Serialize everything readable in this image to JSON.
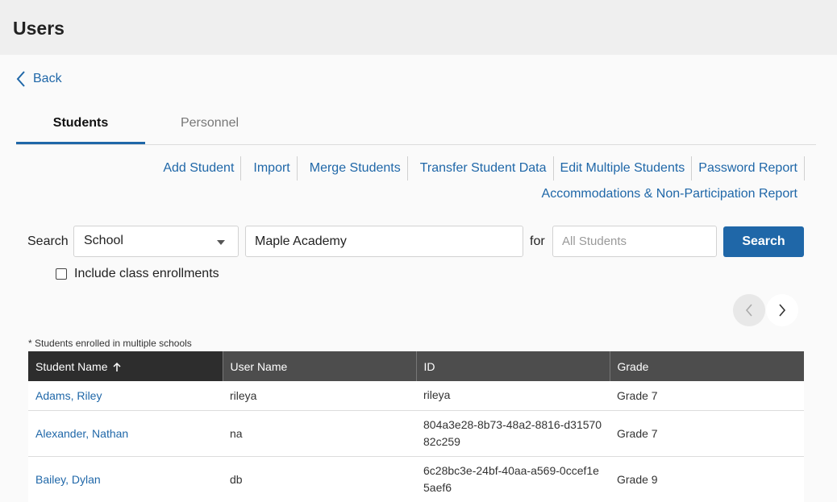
{
  "page": {
    "title": "Users"
  },
  "back": {
    "label": "Back"
  },
  "tabs": [
    {
      "label": "Students",
      "active": true
    },
    {
      "label": "Personnel",
      "active": false
    }
  ],
  "actions": {
    "add_student": "Add Student",
    "import": "Import",
    "merge_students": "Merge Students",
    "transfer_student_data": "Transfer Student Data",
    "edit_multiple_students": "Edit Multiple Students",
    "password_report": "Password Report",
    "accommodations_report": "Accommodations & Non-Participation Report"
  },
  "search": {
    "label": "Search",
    "scope_value": "School",
    "school_value": "Maple Academy",
    "for_label": "for",
    "student_placeholder": "All Students",
    "button_label": "Search"
  },
  "filters": {
    "include_class_enrollments": "Include class enrollments",
    "include_checked": false
  },
  "note": "* Students enrolled in multiple schools",
  "table": {
    "headers": [
      "Student Name",
      "User Name",
      "ID",
      "Grade"
    ],
    "sorted_column": "Student Name",
    "sort_direction": "ascending",
    "rows": [
      {
        "name": "Adams, Riley",
        "username": "rileya",
        "id": "rileya",
        "grade": "Grade 7"
      },
      {
        "name": "Alexander, Nathan",
        "username": "na",
        "id": "804a3e28-8b73-48a2-8816-d3157082c259",
        "grade": "Grade 7"
      },
      {
        "name": "Bailey, Dylan",
        "username": "db",
        "id": "6c28bc3e-24bf-40aa-a569-0ccef1e5aef6",
        "grade": "Grade 9"
      }
    ]
  },
  "colors": {
    "accent": "#1f67a8",
    "header_bg": "#efefef",
    "table_header": "#4d4d4d",
    "table_header_sorted": "#2d2d2d"
  },
  "icons": {
    "back": "chevron-left-icon",
    "sort": "arrow-up-icon",
    "prev": "chevron-left-icon",
    "next": "chevron-right-icon",
    "dropdown": "caret-down-icon"
  }
}
